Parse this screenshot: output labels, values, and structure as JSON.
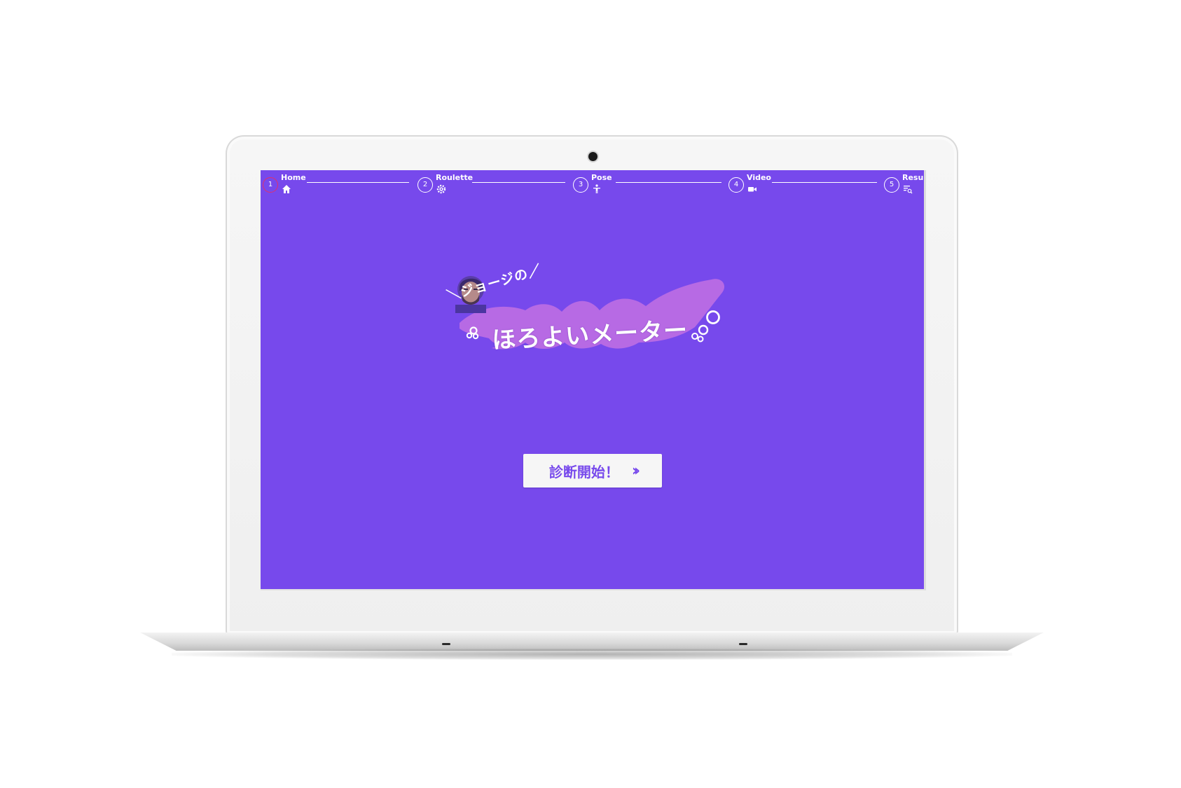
{
  "colors": {
    "screen_background": "#7749ec",
    "accent_brush": "#b76ae4",
    "active_step_ring": "#e0306e",
    "button_background": "#f6f6f6",
    "button_text": "#7749ec"
  },
  "steps": [
    {
      "number": "1",
      "label": "Home",
      "icon": "home-icon",
      "active": true
    },
    {
      "number": "2",
      "label": "Roulette",
      "icon": "gear-icon",
      "active": false
    },
    {
      "number": "3",
      "label": "Pose",
      "icon": "person-icon",
      "active": false
    },
    {
      "number": "4",
      "label": "Video",
      "icon": "video-camera-icon",
      "active": false
    },
    {
      "number": "5",
      "label": "Result",
      "icon": "search-list-icon",
      "active": false
    }
  ],
  "logo": {
    "subtitle": "＼ジョージの／",
    "title": "ほろよいメーター"
  },
  "start_button": {
    "label": "診断開始！",
    "icon": "double-chevron-right-icon"
  }
}
